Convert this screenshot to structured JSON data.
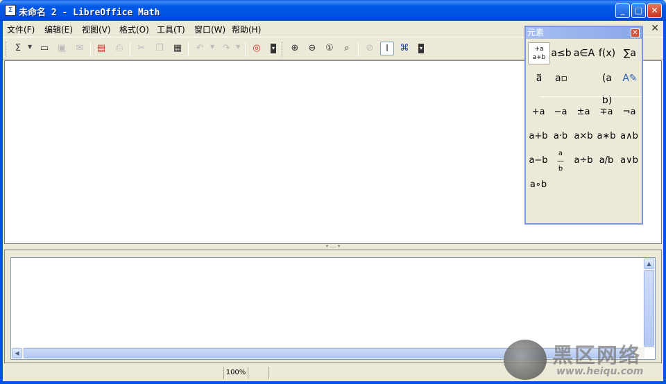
{
  "window": {
    "title": "未命名 2 - LibreOffice Math",
    "app_icon": "document-icon",
    "minimize_glyph": "_",
    "maximize_glyph": "□",
    "close_glyph": "✕"
  },
  "menubar": {
    "items": [
      {
        "label": "文件(F)"
      },
      {
        "label": "编辑(E)"
      },
      {
        "label": "视图(V)"
      },
      {
        "label": "格式(O)"
      },
      {
        "label": "工具(T)"
      },
      {
        "label": "窗口(W)"
      },
      {
        "label": "帮助(H)"
      }
    ],
    "close_glyph": "✕"
  },
  "toolbar": {
    "icons": [
      "new-formula-icon",
      "open-icon",
      "save-icon",
      "email-icon",
      "export-pdf-icon",
      "print-icon",
      "cut-icon",
      "copy-icon",
      "paste-icon",
      "undo-icon",
      "redo-icon",
      "help-icon",
      "zoom-in-icon",
      "zoom-out-icon",
      "zoom-100-icon",
      "show-all-icon",
      "update-icon",
      "formula-cursor-icon",
      "symbols-icon"
    ]
  },
  "elements_panel": {
    "title": "元素",
    "close_glyph": "✕",
    "categories": [
      {
        "label": "+a a+b",
        "selected": true
      },
      {
        "label": "a≤b"
      },
      {
        "label": "a∈A"
      },
      {
        "label": "f(x)"
      },
      {
        "label": "∑a"
      },
      {
        "label": "a⃗"
      },
      {
        "label": "a▫"
      },
      {
        "label": "(a b)"
      },
      {
        "label": "A✎"
      }
    ],
    "symbols": [
      [
        "+a",
        "−a",
        "±a",
        "∓a",
        "¬a"
      ],
      [
        "a+b",
        "a·b",
        "a×b",
        "a∗b",
        "a∧b"
      ],
      [
        "a−b",
        "a/b frac",
        "a÷b",
        "a/b",
        "a∨b"
      ],
      [
        "a∘b"
      ]
    ]
  },
  "splitter": {
    "glyph": "▾ ‥‥ ▾"
  },
  "statusbar": {
    "zoom": "100%"
  },
  "watermark": {
    "text": "黑区网络",
    "url": "www.heiqu.com"
  },
  "colors": {
    "titlebar": "#0054e3",
    "panel_title": "#8aa7e8",
    "face": "#ece9d8"
  }
}
